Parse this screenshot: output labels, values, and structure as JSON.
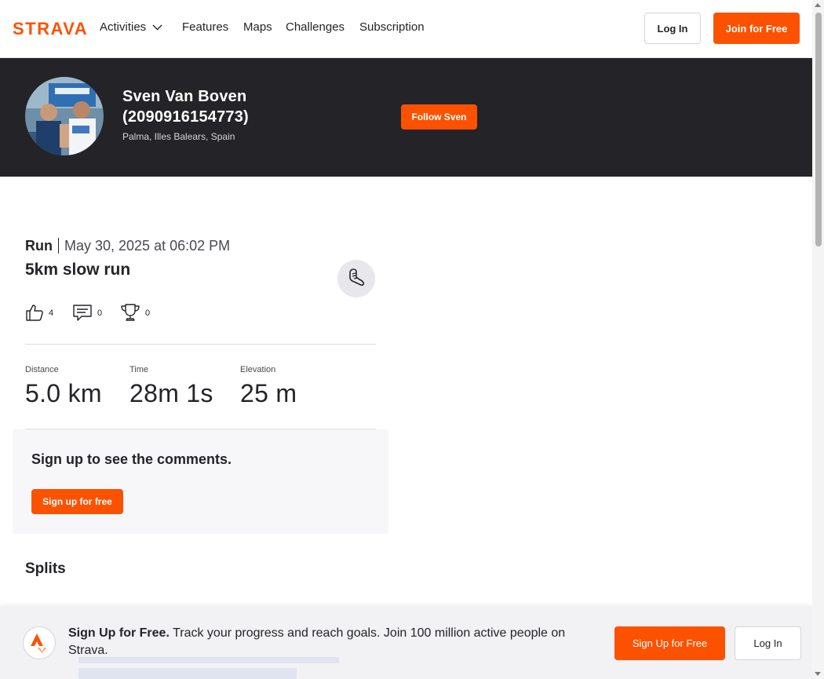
{
  "colors": {
    "brand": "#fc5200",
    "banner_bg": "#242428",
    "text": "#242428"
  },
  "header": {
    "logo_text": "STRAVA",
    "nav": [
      {
        "label": "Activities",
        "has_dropdown": true
      },
      {
        "label": "Features"
      },
      {
        "label": "Maps"
      },
      {
        "label": "Challenges"
      },
      {
        "label": "Subscription"
      }
    ],
    "login_label": "Log In",
    "join_label": "Join for Free"
  },
  "athlete": {
    "name": "Sven Van Boven (2090916154773)",
    "location": "Palma, Illes Balears, Spain",
    "follow_label": "Follow Sven",
    "avatar_icon": "athlete-photo"
  },
  "activity": {
    "type": "Run",
    "date": "May 30, 2025 at 06:02 PM",
    "title": "5km slow run",
    "sport_icon": "shoe-icon",
    "kudos_count": "4",
    "comments_count": "0",
    "achievements_count": "0",
    "stats": [
      {
        "label": "Distance",
        "value": "5.0 km"
      },
      {
        "label": "Time",
        "value": "28m 1s"
      },
      {
        "label": "Elevation",
        "value": "25 m"
      }
    ]
  },
  "comments": {
    "title": "Sign up to see the comments.",
    "button_label": "Sign up for free"
  },
  "splits": {
    "title": "Splits"
  },
  "sticky_banner": {
    "bold_text": "Sign Up for Free.",
    "text": " Track your progress and reach goals. Join 100 million active people on Strava.",
    "signup_label": "Sign Up for Free",
    "login_label": "Log In"
  }
}
